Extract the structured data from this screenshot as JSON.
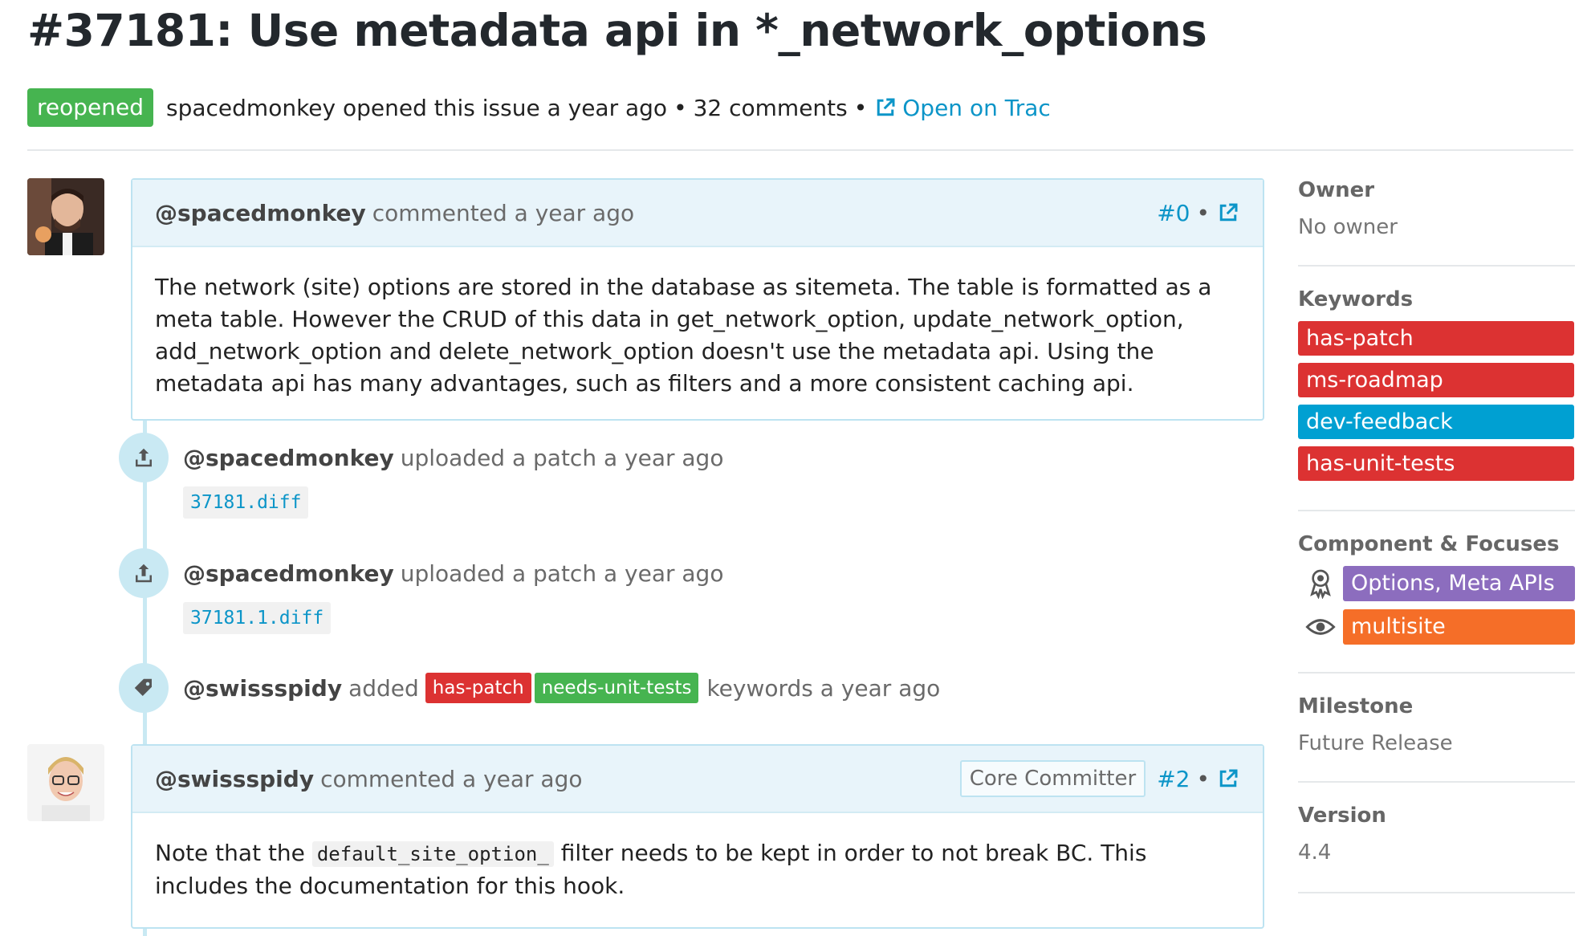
{
  "ticket": {
    "title": "#37181: Use metadata api in *_network_options",
    "status": "reopened",
    "opened_text": "spacedmonkey opened this issue a year ago",
    "bullet": "•",
    "comments_count": "32 comments",
    "trac_link": "Open on Trac"
  },
  "colors": {
    "accent": "#0c95c8",
    "status_green": "#46b450",
    "keyword_red": "#dc3232",
    "keyword_blue": "#00a0d2",
    "keyword_green": "#46b450",
    "component_purple": "#8c6dbe",
    "focus_orange": "#f56e28"
  },
  "comments": [
    {
      "author": "@spacedmonkey",
      "action": "commented a year ago",
      "number": "#0",
      "dot": "•",
      "body": "The network (site) options are stored in the database as sitemeta. The table is formatted as a meta table. However the CRUD of this data in get_network_option, update_network_option, add_network_option and delete_network_option doesn't use the metadata api. Using the metadata api has many advantages, such as filters and a more consistent caching api."
    },
    {
      "author": "@swissspidy",
      "action": "commented a year ago",
      "role": "Core Committer",
      "number": "#2",
      "dot": "•",
      "body_before": "Note that the",
      "body_code": "default_site_option_",
      "body_after": "filter needs to be kept in order to not break BC. This includes the documentation for this hook."
    }
  ],
  "events": [
    {
      "author": "@spacedmonkey",
      "action": "uploaded a patch a year ago",
      "file": "37181.diff",
      "icon": "upload-icon"
    },
    {
      "author": "@spacedmonkey",
      "action": "uploaded a patch a year ago",
      "file": "37181.1.diff",
      "icon": "upload-icon"
    },
    {
      "author": "@swissspidy",
      "action": "added",
      "keywords": [
        "has-patch",
        "needs-unit-tests"
      ],
      "suffix": "keywords a year ago",
      "icon": "tag-icon"
    }
  ],
  "sidebar": {
    "owner_label": "Owner",
    "owner_value": "No owner",
    "keywords_label": "Keywords",
    "keywords": [
      "has-patch",
      "ms-roadmap",
      "dev-feedback",
      "has-unit-tests"
    ],
    "component_label": "Component & Focuses",
    "component": "Options, Meta APIs",
    "focus": "multisite",
    "component_icon": "award-icon",
    "focus_icon": "eye-icon",
    "milestone_label": "Milestone",
    "milestone_value": "Future Release",
    "version_label": "Version",
    "version_value": "4.4"
  }
}
